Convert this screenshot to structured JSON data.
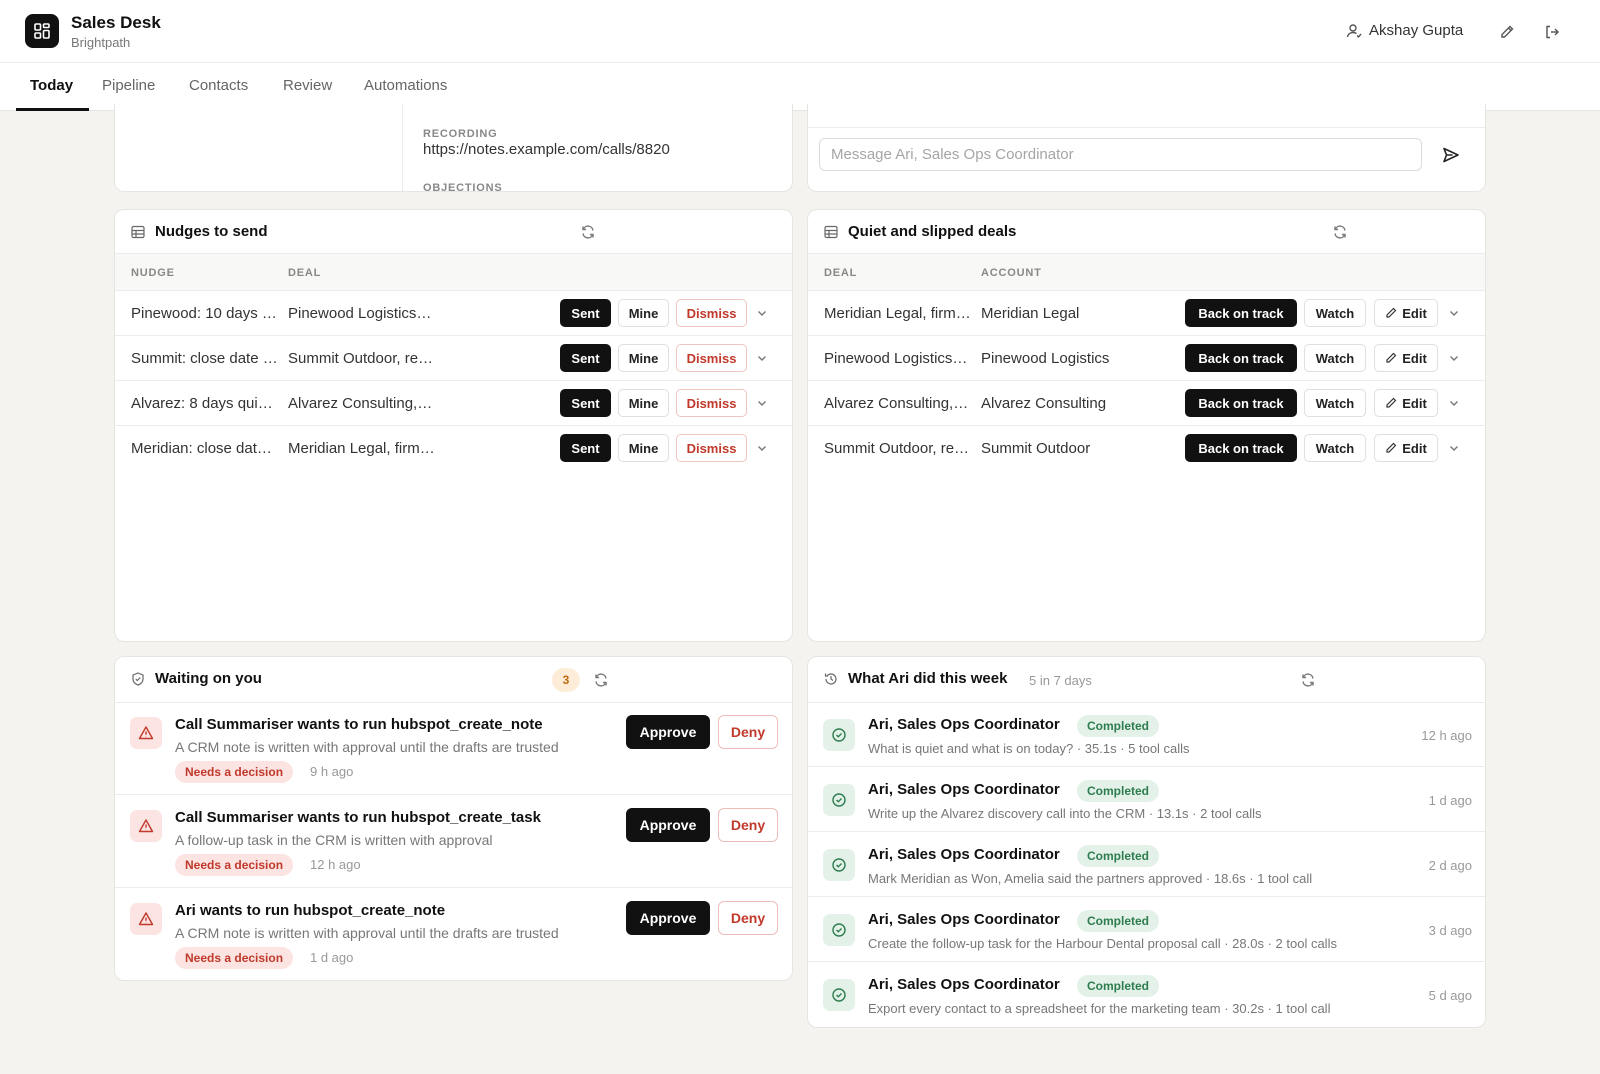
{
  "app": {
    "title": "Sales Desk",
    "org": "Brightpath"
  },
  "user": {
    "name": "Akshay Gupta"
  },
  "tabs": [
    {
      "label": "Today"
    },
    {
      "label": "Pipeline"
    },
    {
      "label": "Contacts"
    },
    {
      "label": "Review"
    },
    {
      "label": "Automations"
    }
  ],
  "call_card": {
    "recording_label": "RECORDING",
    "recording_url": "https://notes.example.com/calls/8820",
    "objections_label": "OBJECTIONS"
  },
  "chat": {
    "placeholder": "Message Ari, Sales Ops Coordinator"
  },
  "nudges": {
    "title": "Nudges to send",
    "columns": [
      "NUDGE",
      "DEAL"
    ],
    "actions": {
      "sent": "Sent",
      "mine": "Mine",
      "dismiss": "Dismiss"
    },
    "rows": [
      {
        "nudge": "Pinewood: 10 days …",
        "deal": "Pinewood Logistics…"
      },
      {
        "nudge": "Summit: close date …",
        "deal": "Summit Outdoor, re…"
      },
      {
        "nudge": "Alvarez: 8 days qui…",
        "deal": "Alvarez Consulting,…"
      },
      {
        "nudge": "Meridian: close dat…",
        "deal": "Meridian Legal, firm…"
      }
    ]
  },
  "deals": {
    "title": "Quiet and slipped deals",
    "columns": [
      "DEAL",
      "ACCOUNT"
    ],
    "actions": {
      "back": "Back on track",
      "watch": "Watch",
      "edit": "Edit"
    },
    "rows": [
      {
        "deal": "Meridian Legal, firm…",
        "account": "Meridian Legal"
      },
      {
        "deal": "Pinewood Logistics…",
        "account": "Pinewood Logistics"
      },
      {
        "deal": "Alvarez Consulting,…",
        "account": "Alvarez Consulting"
      },
      {
        "deal": "Summit Outdoor, re…",
        "account": "Summit Outdoor"
      }
    ]
  },
  "waiting": {
    "title": "Waiting on you",
    "count": "3",
    "approve": "Approve",
    "deny": "Deny",
    "items": [
      {
        "title": "Call Summariser wants to run hubspot_create_note",
        "desc": "A CRM note is written with approval until the drafts are trusted",
        "status": "Needs a decision",
        "time": "9 h ago"
      },
      {
        "title": "Call Summariser wants to run hubspot_create_task",
        "desc": "A follow-up task in the CRM is written with approval",
        "status": "Needs a decision",
        "time": "12 h ago"
      },
      {
        "title": "Ari wants to run hubspot_create_note",
        "desc": "A CRM note is written with approval until the drafts are trusted",
        "status": "Needs a decision",
        "time": "1 d ago"
      }
    ]
  },
  "activity": {
    "title": "What Ari did this week",
    "subtitle": "5 in 7 days",
    "items": [
      {
        "agent": "Ari, Sales Ops Coordinator",
        "status": "Completed",
        "desc": "What is quiet and what is on today? · 35.1s · 5 tool calls",
        "time": "12 h ago"
      },
      {
        "agent": "Ari, Sales Ops Coordinator",
        "status": "Completed",
        "desc": "Write up the Alvarez discovery call into the CRM · 13.1s · 2 tool calls",
        "time": "1 d ago"
      },
      {
        "agent": "Ari, Sales Ops Coordinator",
        "status": "Completed",
        "desc": "Mark Meridian as Won, Amelia said the partners approved · 18.6s · 1 tool call",
        "time": "2 d ago"
      },
      {
        "agent": "Ari, Sales Ops Coordinator",
        "status": "Completed",
        "desc": "Create the follow-up task for the Harbour Dental proposal call · 28.0s · 2 tool calls",
        "time": "3 d ago"
      },
      {
        "agent": "Ari, Sales Ops Coordinator",
        "status": "Completed",
        "desc": "Export every contact to a spreadsheet for the marketing team · 30.2s · 1 tool call",
        "time": "5 d ago"
      }
    ]
  }
}
